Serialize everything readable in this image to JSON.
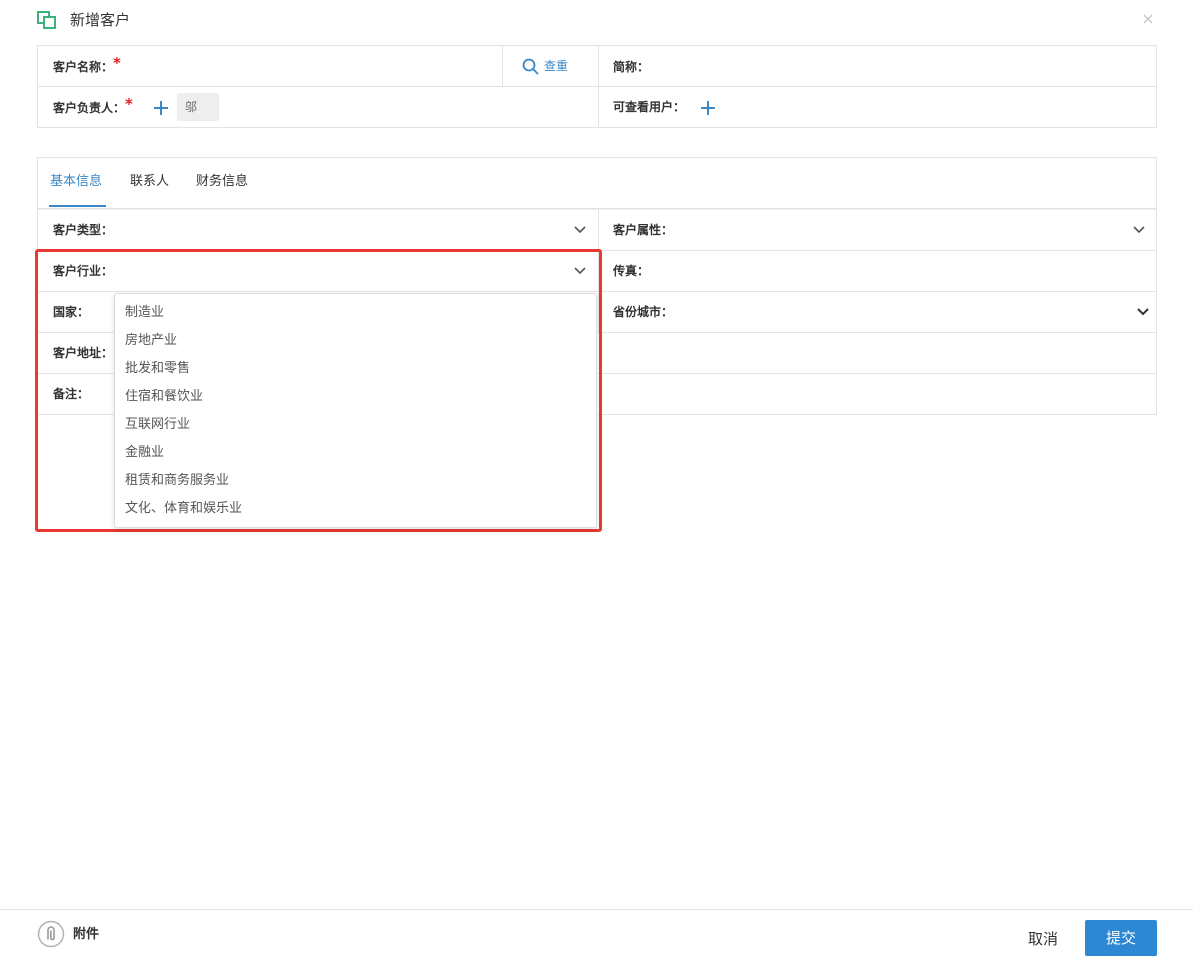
{
  "dialog": {
    "title": "新增客户",
    "close": "×"
  },
  "top_form": {
    "customer_name_label": "客户名称：",
    "required_mark": "*",
    "check_button": "查重",
    "short_name_label": "简称：",
    "owner_label": "客户负责人：",
    "owner_value": "邬",
    "viewers_label": "可查看用户："
  },
  "tabs": [
    {
      "label": "基本信息",
      "active": true
    },
    {
      "label": "联系人",
      "active": false
    },
    {
      "label": "财务信息",
      "active": false
    }
  ],
  "fields": {
    "customer_type": "客户类型：",
    "customer_attr": "客户属性：",
    "industry": "客户行业：",
    "fax": "传真：",
    "country": "国家：",
    "province_city": "省份城市：",
    "address": "客户地址：",
    "remark": "备注："
  },
  "industry_options": [
    "制造业",
    "房地产业",
    "批发和零售",
    "住宿和餐饮业",
    "互联网行业",
    "金融业",
    "租赁和商务服务业",
    "文化、体育和娱乐业"
  ],
  "footer": {
    "attachment_label": "附件",
    "cancel": "取消",
    "submit": "提交"
  },
  "colors": {
    "accent": "#3a87c8",
    "submit_bg": "#2d87d3",
    "required": "#e02020",
    "highlight": "#e83a32",
    "logo_green": "#3bb27a"
  }
}
